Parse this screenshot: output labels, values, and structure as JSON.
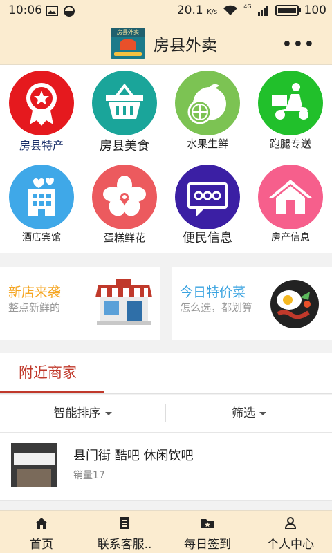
{
  "status_bar": {
    "time": "10:06",
    "speed": "20.1",
    "speed_unit": "K/s",
    "network": "4G",
    "battery": "100"
  },
  "header": {
    "title": "房县外卖",
    "logo_text": "房县外卖",
    "more_label": "•••"
  },
  "categories": [
    {
      "label": "房县特产",
      "icon": "award-star-icon",
      "color": "#e5191e"
    },
    {
      "label": "房县美食",
      "icon": "basket-icon",
      "color": "#1aa59a"
    },
    {
      "label": "水果生鲜",
      "icon": "orange-fruit-icon",
      "color": "#7cc353"
    },
    {
      "label": "跑腿专送",
      "icon": "delivery-scooter-icon",
      "color": "#21c02b"
    },
    {
      "label": "酒店宾馆",
      "icon": "hotel-icon",
      "color": "#3fa8e8"
    },
    {
      "label": "蛋糕鲜花",
      "icon": "flower-icon",
      "color": "#ec5a5e"
    },
    {
      "label": "便民信息",
      "icon": "message-icon",
      "color": "#3b1fa4"
    },
    {
      "label": "房产信息",
      "icon": "house-icon",
      "color": "#f65f8c"
    }
  ],
  "promos": [
    {
      "title": "新店来袭",
      "subtitle": "整点新鲜的",
      "title_color": "#f5a623",
      "image": "storefront-icon"
    },
    {
      "title": "今日特价菜",
      "subtitle": "怎么选，都划算",
      "title_color": "#3aa3e0",
      "image": "fried-egg-bacon-icon"
    }
  ],
  "nearby": {
    "tab_label": "附近商家"
  },
  "filters": {
    "sort_label": "智能排序",
    "filter_label": "筛选"
  },
  "shops": [
    {
      "name": "县门街 酷吧 休闲饮吧",
      "sales": "销量17"
    }
  ],
  "bottom_nav": [
    {
      "label": "首页",
      "icon": "home-icon"
    },
    {
      "label": "联系客服..",
      "icon": "document-icon"
    },
    {
      "label": "每日签到",
      "icon": "folder-star-icon"
    },
    {
      "label": "个人中心",
      "icon": "user-icon"
    }
  ]
}
